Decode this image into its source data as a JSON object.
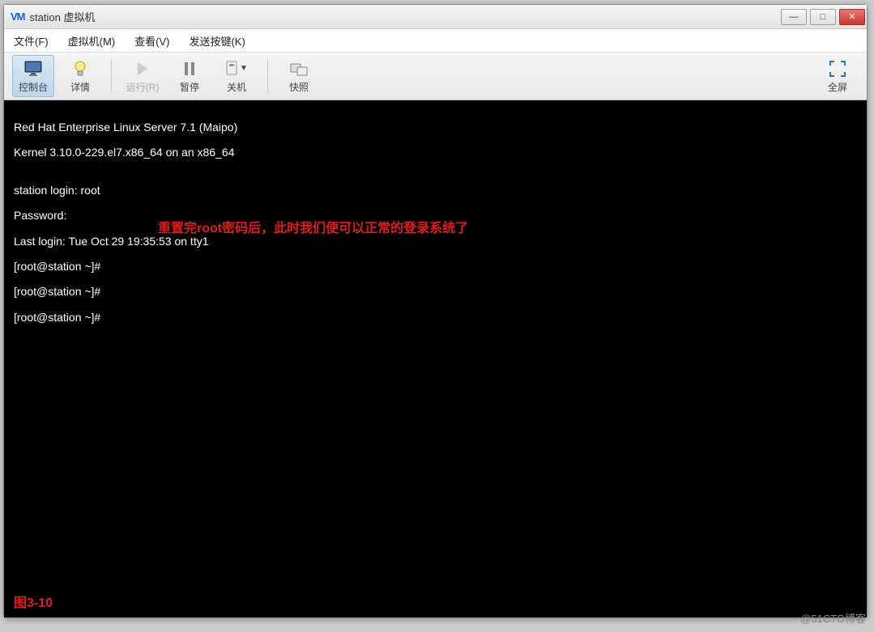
{
  "window": {
    "title_icon": "VM",
    "title": "station 虚拟机"
  },
  "win_controls": {
    "min_glyph": "—",
    "max_glyph": "□",
    "close_glyph": "✕"
  },
  "menu": {
    "file": "文件(F)",
    "vm": "虚拟机(M)",
    "view": "查看(V)",
    "sendkeys": "发送按键(K)"
  },
  "toolbar": {
    "console": "控制台",
    "details": "详情",
    "run": "运行(R)",
    "pause": "暂停",
    "shutdown": "关机",
    "snapshot": "快照",
    "fullscreen": "全屏"
  },
  "console_lines": [
    "Red Hat Enterprise Linux Server 7.1 (Maipo)",
    "Kernel 3.10.0-229.el7.x86_64 on an x86_64",
    "",
    "station login: root",
    "Password:",
    "Last login: Tue Oct 29 19:35:53 on tty1",
    "[root@station ~]#",
    "[root@station ~]#",
    "[root@station ~]#"
  ],
  "annotation": "重置完root密码后，此时我们便可以正常的登录系统了",
  "figure_label": "图3-10",
  "watermark": "@51CTO博客"
}
